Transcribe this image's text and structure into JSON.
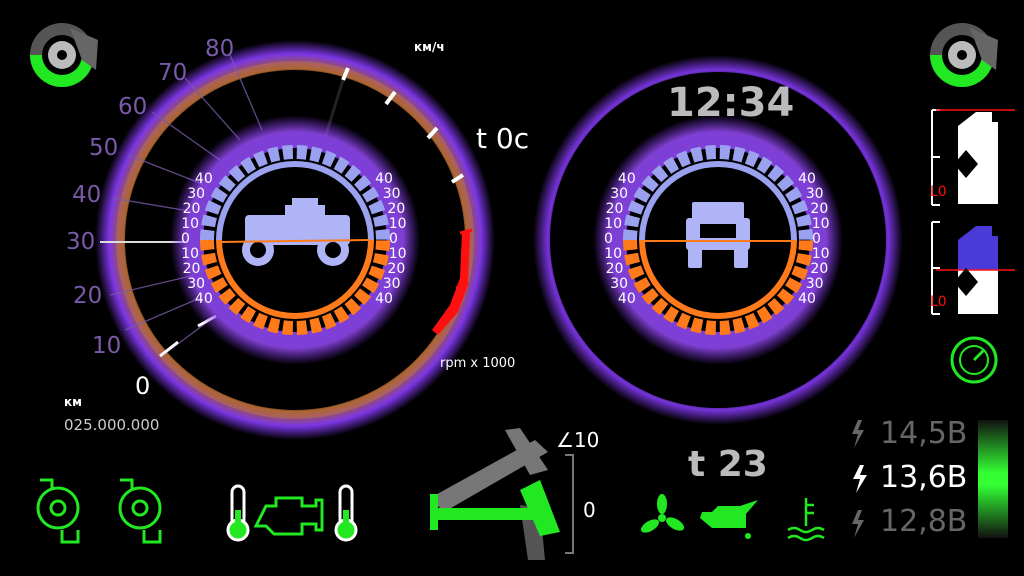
{
  "speedometer": {
    "unit": "км/ч",
    "speed_labels": [
      "0",
      "10",
      "20",
      "30",
      "40",
      "50",
      "60",
      "70",
      "80"
    ],
    "rpm_label": "rpm x 1000",
    "engine_temp": "t  0c"
  },
  "odometer": {
    "unit": "км",
    "value": "025.000.000"
  },
  "clock": {
    "time": "12:34"
  },
  "inclinometer": {
    "scale_labels": [
      "40",
      "30",
      "20",
      "10",
      "0",
      "10",
      "20",
      "30",
      "40"
    ]
  },
  "outside_temp": {
    "value": "t 23"
  },
  "tilt_gauge": {
    "max_label": "∠10",
    "zero_label": "0"
  },
  "fluid_levels": {
    "low_marker": "L0"
  },
  "voltage": {
    "readings": [
      "14,5В",
      "13,6В",
      "12,8В"
    ]
  },
  "colors": {
    "accent_purple": "#8a3cff",
    "accent_orange": "#ff7a1a",
    "indicator_green": "#22e822",
    "warning_red": "#ff1010",
    "glass_blue": "#9aa2f0"
  },
  "icons": [
    "brake-left-icon",
    "brake-right-icon",
    "turbo-left-icon",
    "turbo-right-icon",
    "thermometer-left-icon",
    "check-engine-icon",
    "thermometer-right-icon",
    "fan-icon",
    "oil-icon",
    "coolant-icon",
    "gauge-icon",
    "lightning-icon"
  ]
}
